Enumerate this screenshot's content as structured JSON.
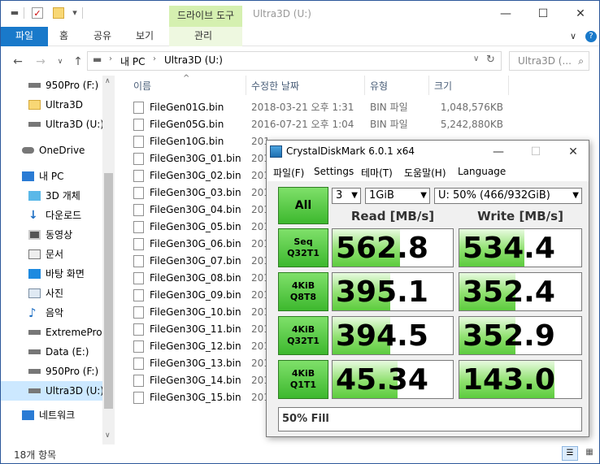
{
  "explorer": {
    "ribbon_context_group": "드라이브 도구",
    "window_title": "Ultra3D (U:)",
    "tabs": [
      "파일",
      "홈",
      "공유",
      "보기",
      "관리"
    ],
    "breadcrumb": [
      "내 PC",
      "Ultra3D (U:)"
    ],
    "search_placeholder": "Ultra3D (...",
    "status": "18개 항목"
  },
  "nav": [
    {
      "label": "950Pro (F:)",
      "icon": "drive-icon"
    },
    {
      "label": "Ultra3D",
      "icon": "folder-icon"
    },
    {
      "label": "Ultra3D (U:)",
      "icon": "drive-icon"
    },
    {
      "label": "OneDrive",
      "icon": "cloud-icon"
    },
    {
      "label": "내 PC",
      "icon": "computer-icon"
    },
    {
      "label": "3D 개체",
      "icon": "cube-icon"
    },
    {
      "label": "다운로드",
      "icon": "download-icon"
    },
    {
      "label": "동영상",
      "icon": "video-icon"
    },
    {
      "label": "문서",
      "icon": "document-icon"
    },
    {
      "label": "바탕 화면",
      "icon": "desktop-icon"
    },
    {
      "label": "사진",
      "icon": "picture-icon"
    },
    {
      "label": "음악",
      "icon": "music-icon"
    },
    {
      "label": "ExtremePro (",
      "icon": "drive-icon"
    },
    {
      "label": "Data (E:)",
      "icon": "drive-icon"
    },
    {
      "label": "950Pro (F:)",
      "icon": "drive-icon"
    },
    {
      "label": "Ultra3D (U:)",
      "icon": "drive-icon"
    },
    {
      "label": "네트워크",
      "icon": "network-icon"
    }
  ],
  "columns": {
    "name": "이름",
    "date": "수정한 날짜",
    "type": "유형",
    "size": "크기"
  },
  "files": [
    {
      "name": "FileGen01G.bin",
      "date": "2018-03-21 오후 1:31",
      "type": "BIN 파일",
      "size": "1,048,576KB"
    },
    {
      "name": "FileGen05G.bin",
      "date": "2016-07-21 오후 1:04",
      "type": "BIN 파일",
      "size": "5,242,880KB"
    },
    {
      "name": "FileGen10G.bin",
      "date": "201",
      "type": "",
      "size": ""
    },
    {
      "name": "FileGen30G_01.bin",
      "date": "201",
      "type": "",
      "size": ""
    },
    {
      "name": "FileGen30G_02.bin",
      "date": "201",
      "type": "",
      "size": ""
    },
    {
      "name": "FileGen30G_03.bin",
      "date": "201",
      "type": "",
      "size": ""
    },
    {
      "name": "FileGen30G_04.bin",
      "date": "201",
      "type": "",
      "size": ""
    },
    {
      "name": "FileGen30G_05.bin",
      "date": "201",
      "type": "",
      "size": ""
    },
    {
      "name": "FileGen30G_06.bin",
      "date": "201",
      "type": "",
      "size": ""
    },
    {
      "name": "FileGen30G_07.bin",
      "date": "201",
      "type": "",
      "size": ""
    },
    {
      "name": "FileGen30G_08.bin",
      "date": "201",
      "type": "",
      "size": ""
    },
    {
      "name": "FileGen30G_09.bin",
      "date": "201",
      "type": "",
      "size": ""
    },
    {
      "name": "FileGen30G_10.bin",
      "date": "201",
      "type": "",
      "size": ""
    },
    {
      "name": "FileGen30G_11.bin",
      "date": "201",
      "type": "",
      "size": ""
    },
    {
      "name": "FileGen30G_12.bin",
      "date": "201",
      "type": "",
      "size": ""
    },
    {
      "name": "FileGen30G_13.bin",
      "date": "201",
      "type": "",
      "size": ""
    },
    {
      "name": "FileGen30G_14.bin",
      "date": "201",
      "type": "",
      "size": ""
    },
    {
      "name": "FileGen30G_15.bin",
      "date": "201",
      "type": "",
      "size": ""
    }
  ],
  "cdm": {
    "title": "CrystalDiskMark 6.0.1 x64",
    "menu": [
      "파일(F)",
      "Settings",
      "테마(T)",
      "도움말(H)",
      "Language"
    ],
    "all_button": "All",
    "count": "3",
    "size": "1GiB",
    "drive": "U: 50% (466/932GiB)",
    "read_header": "Read [MB/s]",
    "write_header": "Write [MB/s]",
    "tests": [
      {
        "line1": "Seq",
        "line2": "Q32T1",
        "read": "562.8",
        "write": "534.4"
      },
      {
        "line1": "4KiB",
        "line2": "Q8T8",
        "read": "395.1",
        "write": "352.4"
      },
      {
        "line1": "4KiB",
        "line2": "Q32T1",
        "read": "394.5",
        "write": "352.9"
      },
      {
        "line1": "4KiB",
        "line2": "Q1T1",
        "read": "45.34",
        "write": "143.0"
      }
    ],
    "comment": "50% Fill"
  }
}
